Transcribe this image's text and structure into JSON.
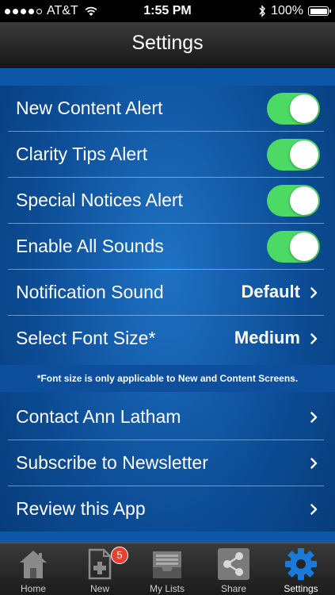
{
  "status_bar": {
    "carrier": "AT&T",
    "time": "1:55 PM",
    "battery": "100%"
  },
  "nav": {
    "title": "Settings"
  },
  "alerts": [
    {
      "label": "New Content Alert",
      "enabled": true
    },
    {
      "label": "Clarity Tips Alert",
      "enabled": true
    },
    {
      "label": "Special Notices Alert",
      "enabled": true
    },
    {
      "label": "Enable All Sounds",
      "enabled": true
    }
  ],
  "options": [
    {
      "label": "Notification Sound",
      "value": "Default"
    },
    {
      "label": "Select Font Size*",
      "value": "Medium"
    }
  ],
  "footnote": "*Font size is only applicable to New and Content Screens.",
  "links": [
    {
      "label": "Contact Ann Latham"
    },
    {
      "label": "Subscribe to Newsletter"
    },
    {
      "label": "Review this App"
    }
  ],
  "tabs": [
    {
      "label": "Home",
      "icon": "home-icon"
    },
    {
      "label": "New",
      "icon": "new-document-icon",
      "badge": "5"
    },
    {
      "label": "My Lists",
      "icon": "inbox-tray-icon"
    },
    {
      "label": "Share",
      "icon": "share-icon"
    },
    {
      "label": "Settings",
      "icon": "gear-icon",
      "active": true
    }
  ],
  "colors": {
    "toggle_on": "#4cd964",
    "background": "#0c4d96",
    "active_tab": "#1a7ad9",
    "badge": "#e8412f"
  }
}
